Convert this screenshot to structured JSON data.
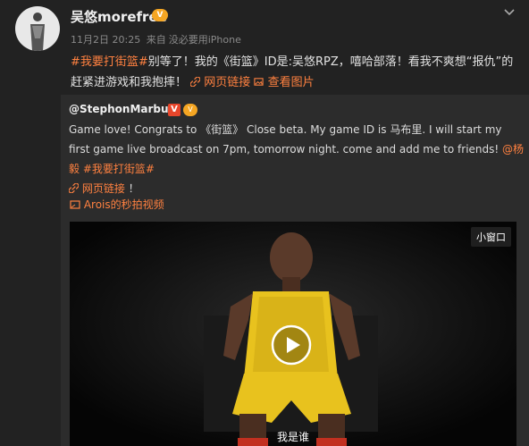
{
  "post": {
    "username": "吴悠morefree",
    "date": "11月2日 20:25",
    "source_prefix": "来自",
    "source": "没必要用iPhone",
    "text": {
      "tag": "#我要打街篮#",
      "body": "别等了！我的《街篮》ID是:吴悠RPZ，嘻哈部落！看我不爽想“报仇”的赶紧进游戏和我抱摔！",
      "web_link": "网页链接",
      "view_image": "查看图片"
    }
  },
  "repost": {
    "author": "@StephonMarbury",
    "text_line": "Game love!  Congrats to 《街篮》 Close beta. My game ID is 马布里. I will start my first game live broadcast on 7pm, tomorrow night.  come and add me to friends! ",
    "mention": "@杨毅",
    "tag": "#我要打街篮#",
    "web_link": "网页链接",
    "end": "！",
    "video_source": "Arois的秒拍视频",
    "mini_window": "小窗口",
    "subtitle": "我是谁"
  },
  "colors": {
    "link": "#ff8140",
    "badge": "#f5a623",
    "background": "#222222"
  },
  "icons": [
    "chevron-down-icon",
    "link-icon",
    "image-icon",
    "video-icon",
    "play-icon"
  ]
}
